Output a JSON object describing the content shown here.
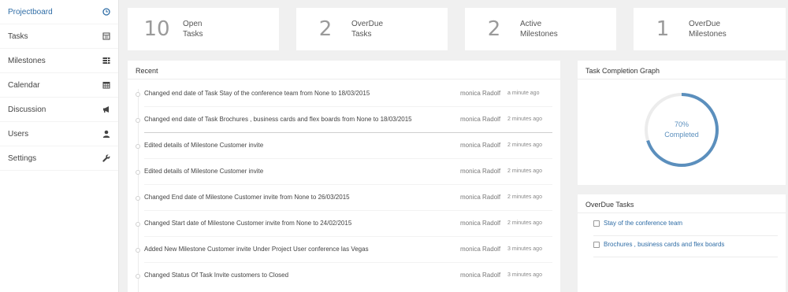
{
  "sidebar": {
    "items": [
      {
        "label": "Projectboard",
        "icon": "clock-icon"
      },
      {
        "label": "Tasks",
        "icon": "calendar-grid-icon"
      },
      {
        "label": "Milestones",
        "icon": "list-icon"
      },
      {
        "label": "Calendar",
        "icon": "calendar-icon"
      },
      {
        "label": "Discussion",
        "icon": "megaphone-icon"
      },
      {
        "label": "Users",
        "icon": "user-icon"
      },
      {
        "label": "Settings",
        "icon": "wrench-icon"
      }
    ]
  },
  "stats": [
    {
      "value": "10",
      "line1": "Open",
      "line2": "Tasks"
    },
    {
      "value": "2",
      "line1": "OverDue",
      "line2": "Tasks"
    },
    {
      "value": "2",
      "line1": "Active",
      "line2": "Milestones"
    },
    {
      "value": "1",
      "line1": "OverDue",
      "line2": "Milestones"
    }
  ],
  "recent": {
    "title": "Recent",
    "rows": [
      {
        "desc": "Changed end date of Task Stay of the conference team from None to 18/03/2015",
        "user": "monica Radolf",
        "time": "a minute ago"
      },
      {
        "desc": "Changed end date of Task Brochures , business cards and flex boards from None to 18/03/2015",
        "user": "monica Radolf",
        "time": "2 minutes ago"
      },
      {
        "desc": "Edited details of Milestone Customer invite",
        "user": "monica Radolf",
        "time": "2 minutes ago"
      },
      {
        "desc": "Edited details of Milestone Customer invite",
        "user": "monica Radolf",
        "time": "2 minutes ago"
      },
      {
        "desc": "Changed End date of Milestone Customer invite from None to 26/03/2015",
        "user": "monica Radolf",
        "time": "2 minutes ago"
      },
      {
        "desc": "Changed Start date of Milestone Customer invite from None to 24/02/2015",
        "user": "monica Radolf",
        "time": "2 minutes ago"
      },
      {
        "desc": "Added New Milestone Customer invite Under Project User conference las Vegas",
        "user": "monica Radolf",
        "time": "3 minutes ago"
      },
      {
        "desc": "Changed Status Of Task Invite customers to Closed",
        "user": "monica Radolf",
        "time": "3 minutes ago"
      }
    ]
  },
  "graph": {
    "title": "Task Completion Graph",
    "percent_label": "70%",
    "status_label": "Completed",
    "completion_fraction": 0.7,
    "ring_color": "#5b8fbd",
    "track_color": "#ececec"
  },
  "overdue": {
    "title": "OverDue Tasks",
    "tasks": [
      {
        "label": "Stay of the conference team"
      },
      {
        "label": "Brochures , business cards and flex boards"
      }
    ]
  }
}
